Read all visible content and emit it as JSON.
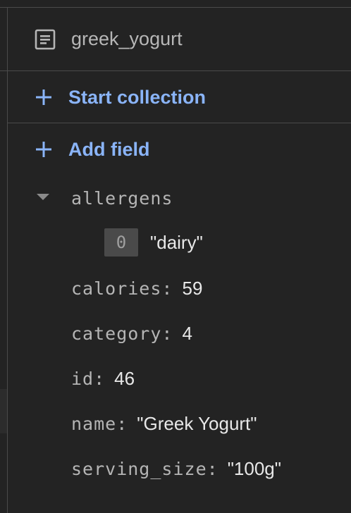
{
  "document": {
    "name": "greek_yogurt",
    "icon": "document-icon"
  },
  "actions": {
    "start_collection": "Start collection",
    "add_field": "Add field",
    "icon": "plus-icon"
  },
  "colors": {
    "accent": "#8ab4f8",
    "background": "#232323",
    "divider": "#4a4a4a"
  },
  "fields": {
    "allergens": {
      "key": "allergens",
      "items": [
        {
          "index": "0",
          "value": "\"dairy\""
        }
      ]
    },
    "calories": {
      "key": "calories",
      "value": "59"
    },
    "category": {
      "key": "category",
      "value": "4"
    },
    "id": {
      "key": "id",
      "value": "46"
    },
    "name": {
      "key": "name",
      "value": "\"Greek Yogurt\""
    },
    "serving_size": {
      "key": "serving_size",
      "value": "\"100g\""
    }
  }
}
